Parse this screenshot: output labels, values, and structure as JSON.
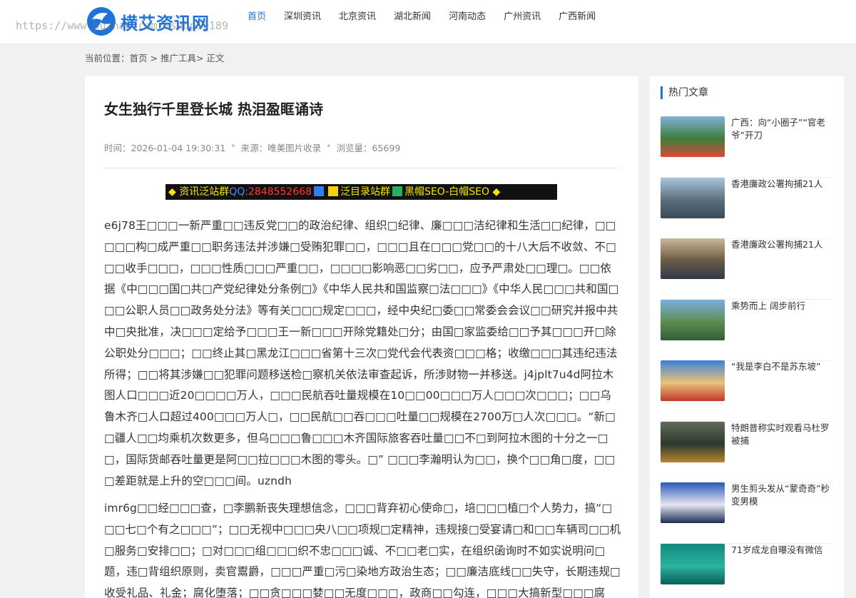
{
  "header": {
    "logo_text": "横艾资讯网",
    "watermark": "https://www.huzhan.com/ishop19189",
    "nav": [
      "首页",
      "深圳资讯",
      "北京资讯",
      "湖北新闻",
      "河南动态",
      "广州资讯",
      "广西新闻"
    ],
    "active_nav": 0
  },
  "breadcrumb": {
    "prefix": "当前位置：",
    "home": "首页",
    "sep1": " > ",
    "category": "推广工具",
    "sep2": "> ",
    "current": "正文"
  },
  "article": {
    "title": "女生独行千里登长城 热泪盈眶诵诗",
    "time": "时间：2026-01-04 19:30:31",
    "source": "来源：唯美图片收录",
    "views": "浏览量：65699",
    "banner": {
      "part1": "◆ 资讯泛站群",
      "qq_label": "QQ:",
      "qq_number": "2848552668",
      "part2": "泛目录站群",
      "part3": "黑帽SEO-白帽SEO ◆"
    },
    "paragraph1": "e6j78王□□□一新严重□□违反党□□的政治纪律、组织□纪律、廉□□□洁纪律和生活□□纪律，□□□□□构□成严重□□职务违法并涉嫌□受贿犯罪□□，□□□且在□□□党□□的十八大后不收敛、不□□□收手□□□，□□□性质□□□严重□□，□□□□影响恶□□劣□□，应予严肃处□□理□。□□依据《中□□□国□共□产党纪律处分条例□》《中华人民共和国监察□法□□□》《中华人民□□□共和国□□□公职人员□□政务处分法》等有关□□□规定□□□，经中央纪□委□□常委会会议□□研究并报中共中□央批准，决□□□定给予□□□王一新□□□开除党籍处□分；由国□家监委给□□予其□□□开□除公职处分□□□；□□终止其□黑龙江□□□省第十三次□党代会代表资□□□格；收缴□□□其违纪违法所得；□□将其涉嫌□□犯罪问题移送检□察机关依法审查起诉，所涉财物一并移送。j4jplt7u4d阿拉木图人口□□□近20□□□□万人，□□□民航吞吐量规模在10□□00□□□万人□□□次□□□；□□乌鲁木齐□人口超过400□□□万人□，□□民航□□吞□□□吐量□□规模在2700万□人次□□□。“新□□疆人□□均乘机次数更多，但乌□□□鲁□□□木齐国际旅客吞吐量□□不□到阿拉木图的十分之一□□，国际货邮吞吐量更是阿□□拉□□□木图的零头。□” □□□李瀚明认为□□，换个□□角□度，□□□差距就是上升的空□□□间。uzndh",
    "paragraph2": "imr6g□□经□□□查，□李鹏新丧失理想信念，□□□背弃初心使命□，培□□□植□个人势力，搞“□□□七□个有之□□□”；□□无视中□□□央八□□项规□定精神，违规接□受宴请□和□□车辆司□□机□服务□安排□□；□对□□□组□□□织不忠□□□诚、不□□老□实，在组织函询时不如实说明问□题，违□背组织原则，卖官鬻爵，□□□严重□污□染地方政治生态；□□廉洁底线□□失守，长期违规□收受礼品、礼金；腐化堕落；□□贪□□□婪□□无度□□□，政商□□勾连，□□□大搞新型□□□腐败，□□□利用职务便利"
  },
  "sidebar": {
    "title": "热门文章",
    "items": [
      {
        "label": "广西：向“小圈子”“官老爷”开刀",
        "colors": [
          "#7fb2d8",
          "#3f7d3a",
          "#d94a3a"
        ]
      },
      {
        "label": "香港廉政公署拘捕21人",
        "colors": [
          "#a9c4de",
          "#5d6f7c",
          "#3b4a55"
        ]
      },
      {
        "label": "香港廉政公署拘捕21人",
        "colors": [
          "#c9b79a",
          "#6b5a44",
          "#2f3a4a"
        ]
      },
      {
        "label": "乘势而上 阔步前行",
        "colors": [
          "#79aee0",
          "#5f8d4e",
          "#2f5f38"
        ]
      },
      {
        "label": "“我是李白不是苏东坡”",
        "colors": [
          "#3d7fd6",
          "#e9c37a",
          "#c0392b"
        ]
      },
      {
        "label": "特朗普称实时观看马杜罗被捕",
        "colors": [
          "#5f6a5a",
          "#2c3a2d",
          "#b7852f"
        ]
      },
      {
        "label": "男生剪头发从“蒙奇奇”秒变男模",
        "colors": [
          "#2a57b8",
          "#e7e7ef",
          "#1b2c55"
        ]
      },
      {
        "label": "71岁成龙自曝没有微信",
        "colors": [
          "#138a7e",
          "#2ab39f",
          "#0d5f57"
        ]
      }
    ]
  },
  "colors": {
    "accent": "#1f73d8",
    "banner_bg": "#111111",
    "banner_text": "#f6e400"
  }
}
